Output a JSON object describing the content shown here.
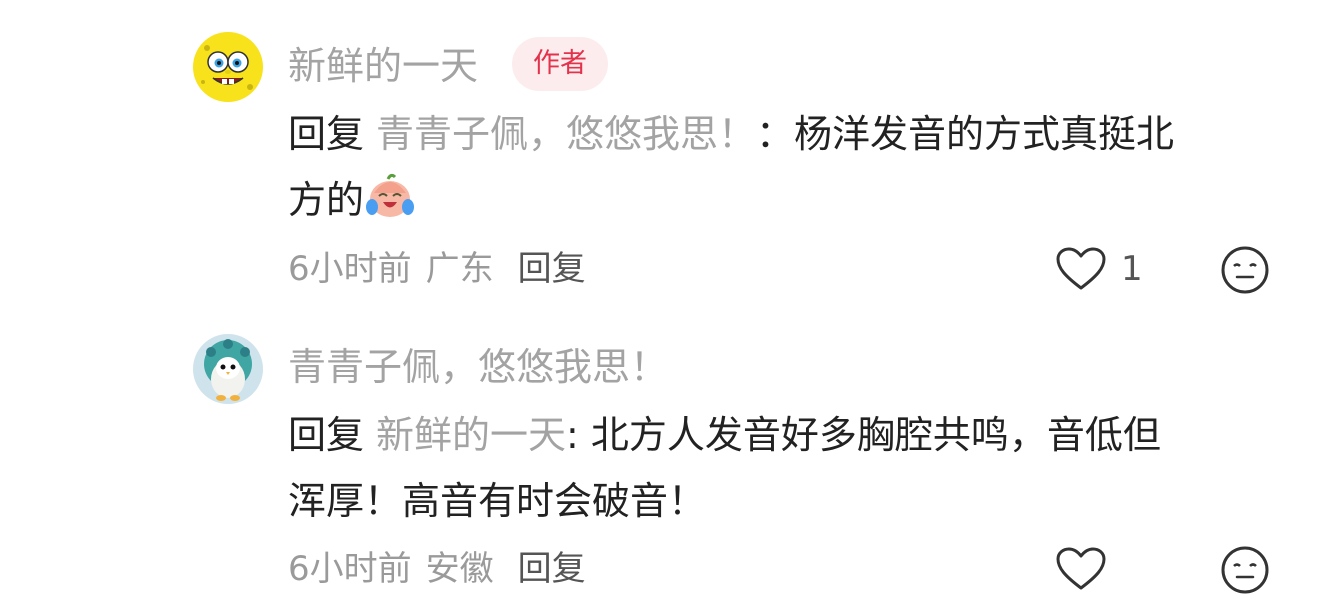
{
  "comments": [
    {
      "username": "新鲜的一天",
      "badge": "作者",
      "reply_word": "回复",
      "reply_target": "青青子佩，悠悠我思！",
      "text_line1": "：杨洋发音的方式真挺北",
      "text_line2": "方的",
      "emoji": "crying-laughing-face",
      "time": "6小时前",
      "location": "广东",
      "reply_label": "回复",
      "like_count": "1",
      "avatar": "spongebob-avatar"
    },
    {
      "username": "青青子佩，悠悠我思！",
      "reply_word": "回复",
      "reply_target": "新鲜的一天",
      "text_line1": ": 北方人发音好多胸腔共鸣，音低但",
      "text_line2": "浑厚！高音有时会破音！",
      "time": "6小时前",
      "location": "安徽",
      "reply_label": "回复",
      "avatar": "peacock-plush-avatar"
    }
  ],
  "colors": {
    "username": "#a3a3a3",
    "text": "#222222",
    "meta": "#9a9a9a",
    "badge_text": "#e3324c",
    "badge_bg": "#fdeced"
  }
}
